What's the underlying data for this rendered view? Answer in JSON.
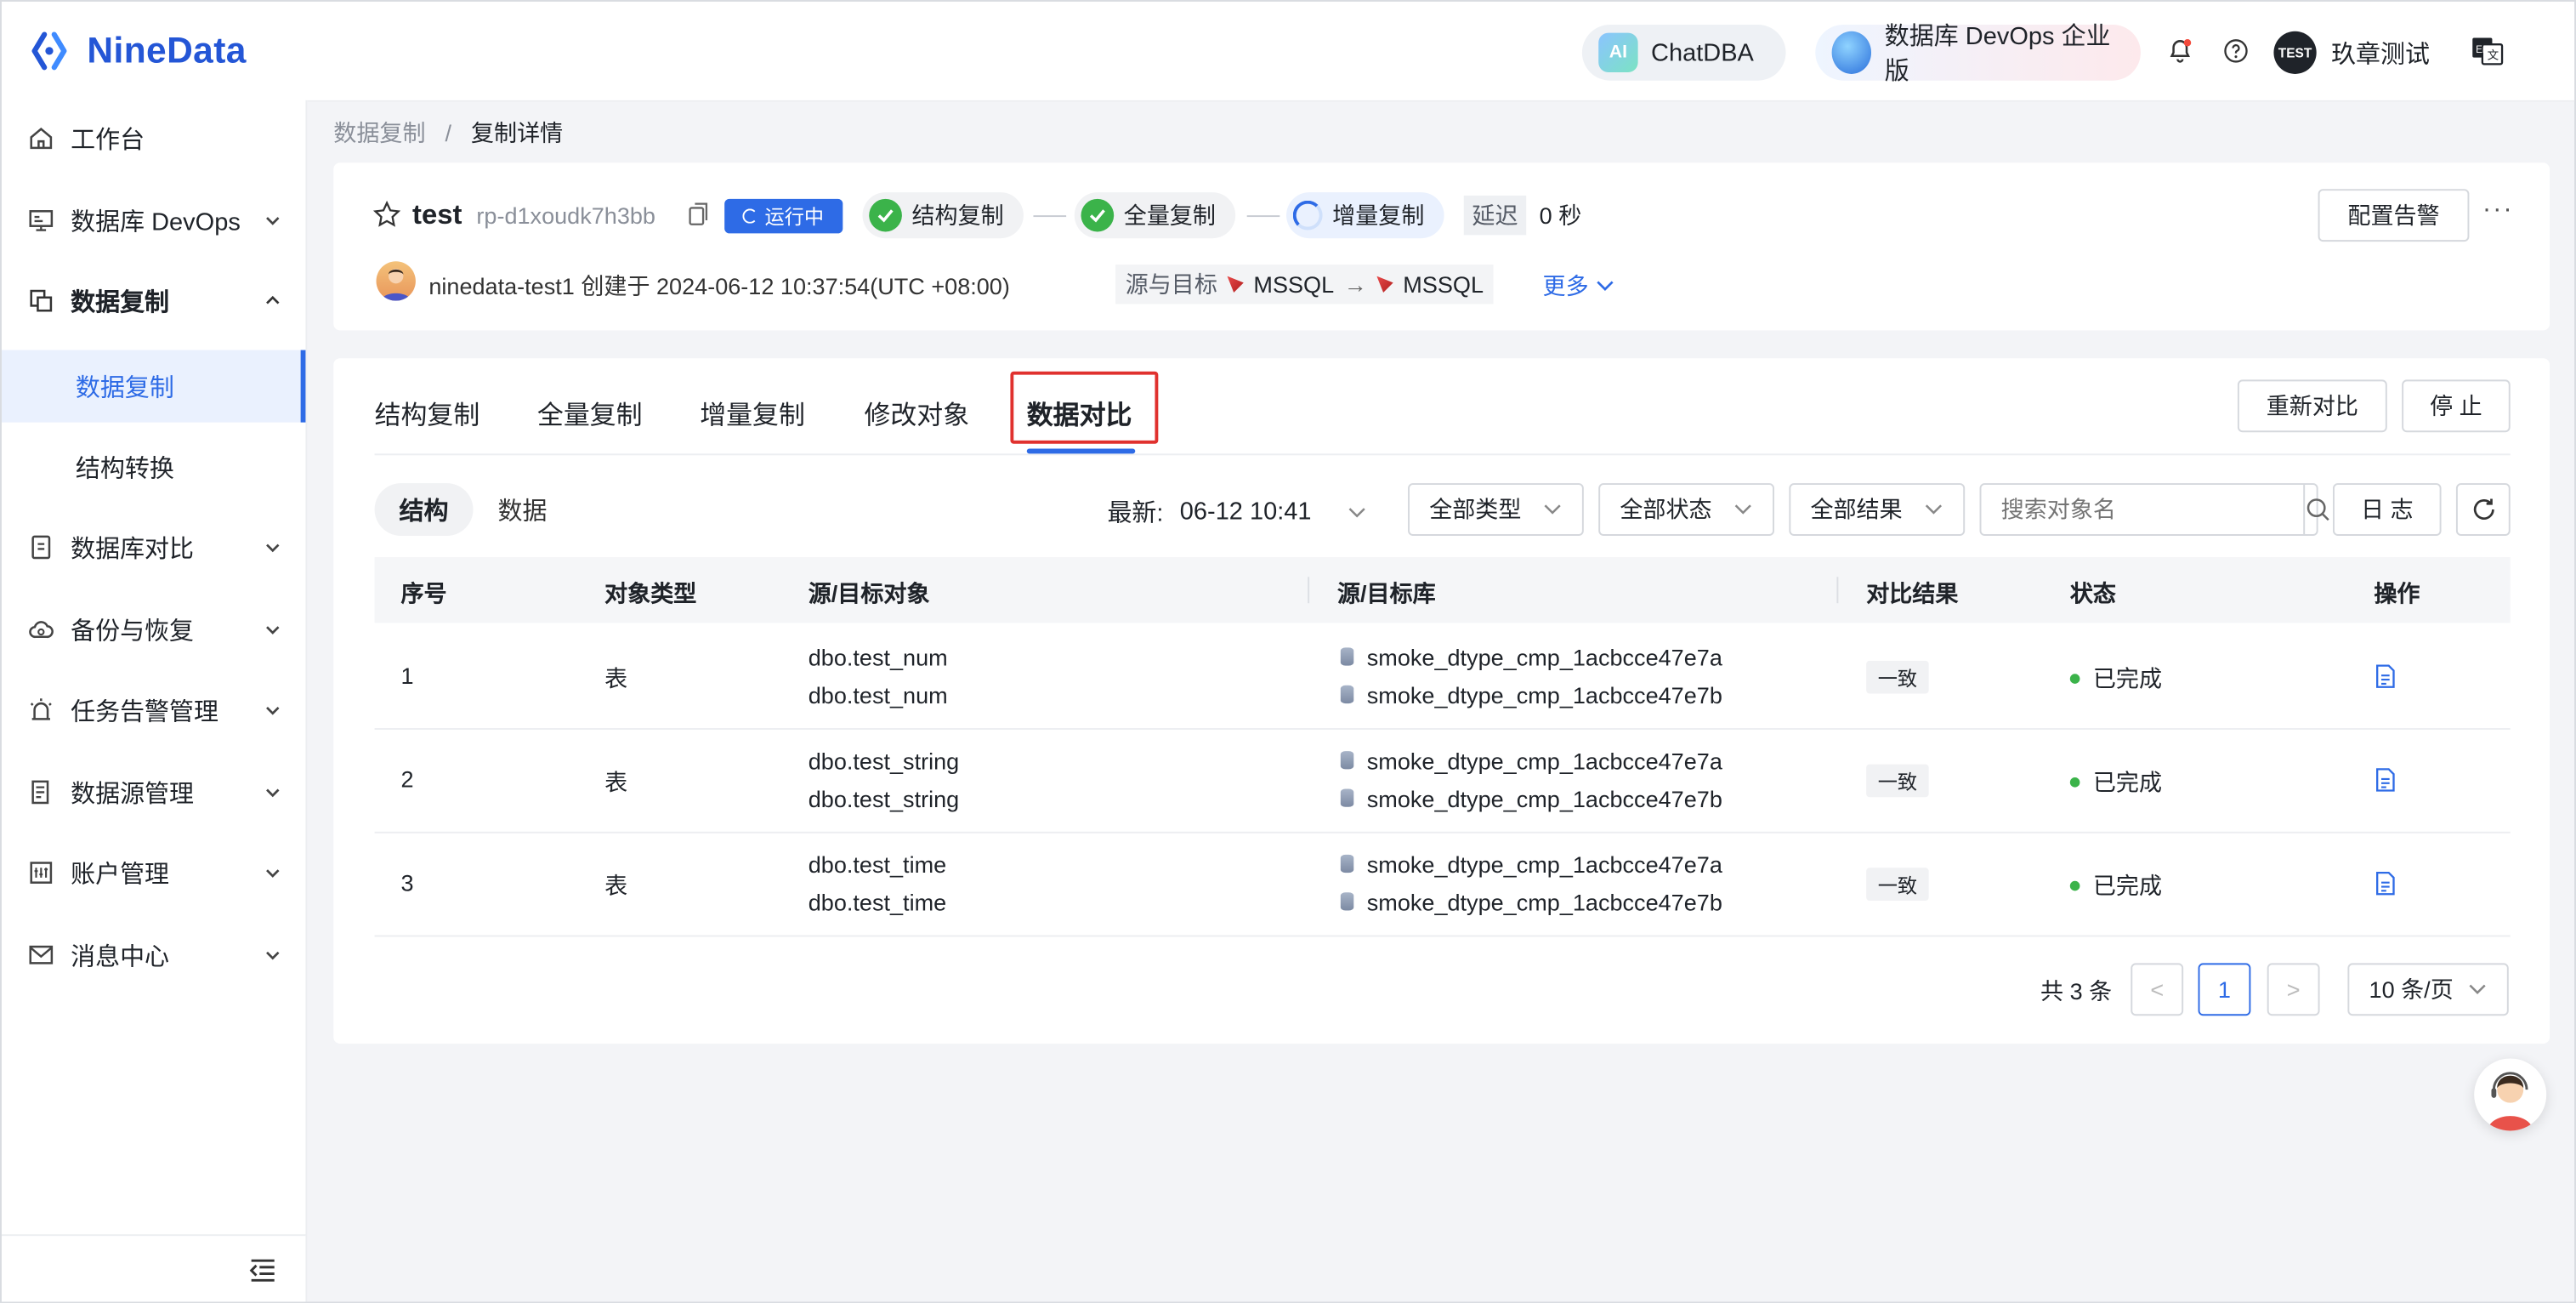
{
  "app": {
    "logo_text": "NineData"
  },
  "topbar": {
    "chatdba_label": "ChatDBA",
    "ai_badge": "AI",
    "devops_label": "数据库 DevOps 企业版",
    "avatar_text": "TEST",
    "user_name": "玖章测试"
  },
  "sidebar": {
    "items": [
      {
        "label": "工作台",
        "icon": "home-icon"
      },
      {
        "label": "数据库 DevOps",
        "icon": "monitor-icon"
      },
      {
        "label": "数据复制",
        "icon": "copy-icon",
        "expanded": true
      },
      {
        "label": "数据复制",
        "sub": true,
        "active": true
      },
      {
        "label": "结构转换",
        "sub": true
      },
      {
        "label": "数据库对比",
        "icon": "compare-icon"
      },
      {
        "label": "备份与恢复",
        "icon": "cloud-icon"
      },
      {
        "label": "任务告警管理",
        "icon": "alarm-icon"
      },
      {
        "label": "数据源管理",
        "icon": "datasource-icon"
      },
      {
        "label": "账户管理",
        "icon": "account-icon"
      },
      {
        "label": "消息中心",
        "icon": "mail-icon"
      }
    ]
  },
  "breadcrumb": {
    "parent": "数据复制",
    "sep": "/",
    "current": "复制详情"
  },
  "task": {
    "name": "test",
    "id": "rp-d1xoudk7h3bb",
    "status": "运行中",
    "steps": [
      "结构复制",
      "全量复制",
      "增量复制"
    ],
    "delay_label": "延迟",
    "delay_value": "0 秒",
    "alarm_button": "配置告警",
    "more_dots": "···",
    "owner_text": "ninedata-test1 创建于 2024-06-12 10:37:54(UTC +08:00)",
    "src_tgt_label": "源与目标",
    "source_db": "MSSQL",
    "arrow": "→",
    "target_db": "MSSQL",
    "more_link": "更多"
  },
  "tabs": {
    "items": [
      "结构复制",
      "全量复制",
      "增量复制",
      "修改对象",
      "数据对比"
    ],
    "active_index": 4,
    "recompare_button": "重新对比",
    "stop_button": "停 止"
  },
  "toolbar": {
    "segment_on": "结构",
    "segment_off": "数据",
    "latest_label": "最新:",
    "latest_value": "06-12 10:41",
    "type_filter": "全部类型",
    "status_filter": "全部状态",
    "result_filter": "全部结果",
    "search_placeholder": "搜索对象名",
    "log_button": "日 志"
  },
  "table": {
    "headers": [
      "序号",
      "对象类型",
      "源/目标对象",
      "源/目标库",
      "对比结果",
      "状态",
      "操作"
    ],
    "rows": [
      {
        "no": "1",
        "type": "表",
        "src_obj": "dbo.test_num",
        "tgt_obj": "dbo.test_num",
        "src_db": "smoke_dtype_cmp_1acbcce47e7a",
        "tgt_db": "smoke_dtype_cmp_1acbcce47e7b",
        "result": "一致",
        "status": "已完成"
      },
      {
        "no": "2",
        "type": "表",
        "src_obj": "dbo.test_string",
        "tgt_obj": "dbo.test_string",
        "src_db": "smoke_dtype_cmp_1acbcce47e7a",
        "tgt_db": "smoke_dtype_cmp_1acbcce47e7b",
        "result": "一致",
        "status": "已完成"
      },
      {
        "no": "3",
        "type": "表",
        "src_obj": "dbo.test_time",
        "tgt_obj": "dbo.test_time",
        "src_db": "smoke_dtype_cmp_1acbcce47e7a",
        "tgt_db": "smoke_dtype_cmp_1acbcce47e7b",
        "result": "一致",
        "status": "已完成"
      }
    ]
  },
  "pagination": {
    "total_text": "共 3 条",
    "prev": "<",
    "current_page": "1",
    "next": ">",
    "page_size": "10 条/页"
  },
  "colors": {
    "accent": "#2e6be6",
    "success": "#3bb34a",
    "highlight_border": "#e0312e"
  }
}
